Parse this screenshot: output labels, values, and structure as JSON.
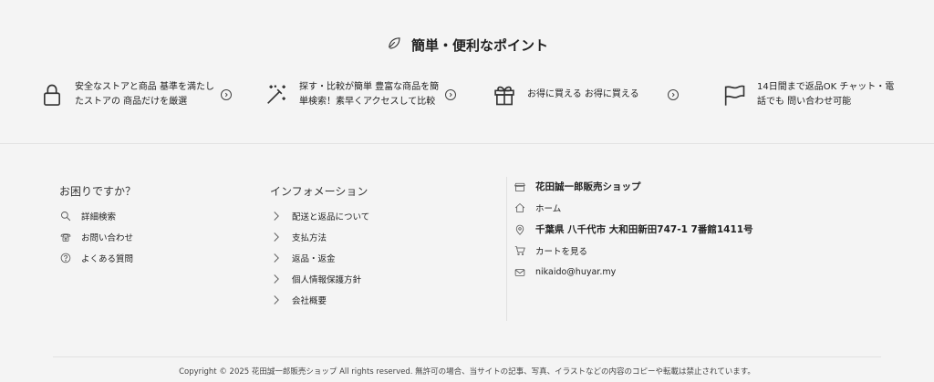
{
  "points_section": {
    "title": "簡単・便利なポイント",
    "items": [
      {
        "icon": "lock-icon",
        "text": "安全なストアと商品 基準を満たしたストアの 商品だけを厳選"
      },
      {
        "icon": "magic-wand-icon",
        "text": "探す・比較が簡単 豊富な商品を簡単検索！素早くアクセスして比較"
      },
      {
        "icon": "gift-icon",
        "text": "お得に買える お得に買える"
      },
      {
        "icon": "flag-icon",
        "text": "14日間まで返品OK チャット・電話でも 問い合わせ可能"
      }
    ]
  },
  "help": {
    "title": "お困りですか？",
    "links": [
      {
        "icon": "search-icon",
        "label": "詳細検索"
      },
      {
        "icon": "phone-icon",
        "label": "お問い合わせ"
      },
      {
        "icon": "question-icon",
        "label": "よくある質問"
      }
    ]
  },
  "info": {
    "title": "インフォメーション",
    "links": [
      {
        "icon": "chevron-right-icon",
        "label": "配送と返品について"
      },
      {
        "icon": "chevron-right-icon",
        "label": "支払方法"
      },
      {
        "icon": "chevron-right-icon",
        "label": "返品・返金"
      },
      {
        "icon": "chevron-right-icon",
        "label": "個人情報保護方針"
      },
      {
        "icon": "chevron-right-icon",
        "label": "会社概要"
      }
    ]
  },
  "shop": {
    "name": "花田誠一郎販売ショップ",
    "home": "ホーム",
    "address": "千葉県 八千代市 大和田新田747-1 7番館1411号",
    "cart": "カートを見る",
    "email": "nikaido@huyar.my"
  },
  "footer": {
    "copyright": "Copyright © 2025 花田誠一郎販売ショップ All rights reserved.   無許可の場合、当サイトの記事、写真、イラストなどの内容のコピーや転載は禁止されています。"
  }
}
